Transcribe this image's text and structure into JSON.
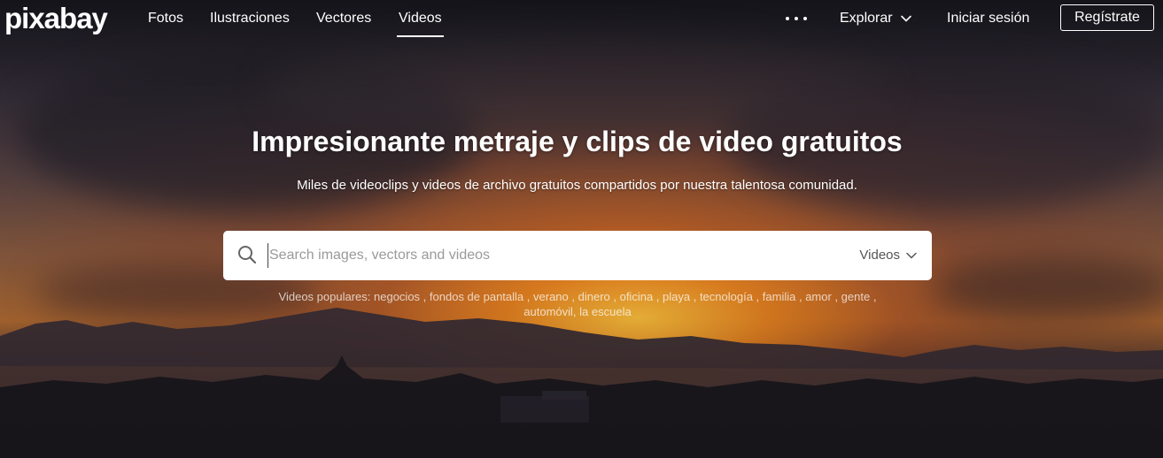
{
  "brand": {
    "logo_text": "pixabay"
  },
  "nav": {
    "links": [
      {
        "label": "Fotos"
      },
      {
        "label": "Ilustraciones"
      },
      {
        "label": "Vectores"
      },
      {
        "label": "Videos",
        "active": true
      }
    ],
    "more_icon": "more-dots-icon",
    "explore_label": "Explorar",
    "login_label": "Iniciar sesión",
    "register_label": "Regístrate"
  },
  "hero": {
    "title": "Impresionante metraje y clips de video gratuitos",
    "subtitle": "Miles de videoclips y videos de archivo gratuitos compartidos por nuestra talentosa comunidad."
  },
  "search": {
    "placeholder": "Search images, vectors and videos",
    "value": "",
    "type_selected": "Videos",
    "icon": "search-icon"
  },
  "popular": {
    "label": "Videos populares:",
    "tags": [
      "negocios",
      "fondos de pantalla",
      "verano",
      "dinero",
      "oficina",
      "playa",
      "tecnología",
      "familia",
      "amor",
      "gente",
      "automóvil",
      "la escuela"
    ]
  },
  "colors": {
    "text": "#ffffff",
    "search_bg": "#ffffff",
    "placeholder": "#9a9a9a",
    "sun": "#f5a623"
  }
}
